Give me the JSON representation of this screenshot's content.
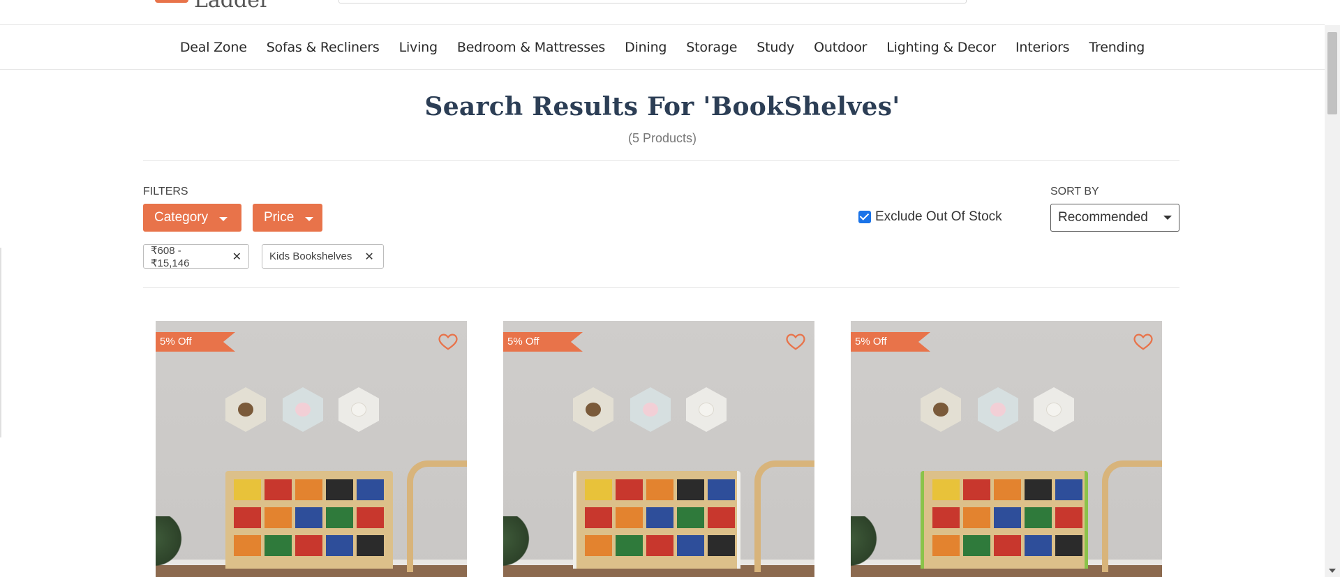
{
  "header": {
    "logo_text": "Ladder"
  },
  "nav": {
    "items": [
      "Deal Zone",
      "Sofas & Recliners",
      "Living",
      "Bedroom & Mattresses",
      "Dining",
      "Storage",
      "Study",
      "Outdoor",
      "Lighting & Decor",
      "Interiors",
      "Trending"
    ]
  },
  "results": {
    "title": "Search Results For 'BookShelves'",
    "count": "(5 Products)"
  },
  "filters": {
    "label": "FILTERS",
    "category_label": "Category",
    "price_label": "Price",
    "chips": [
      "₹608 - ₹15,146",
      "Kids Bookshelves"
    ]
  },
  "stock": {
    "label": "Exclude Out Of Stock",
    "checked": true
  },
  "sort": {
    "label": "SORT BY",
    "selected": "Recommended"
  },
  "products": [
    {
      "badge": "5% Off"
    },
    {
      "badge": "5% Off"
    },
    {
      "badge": "5% Off"
    }
  ],
  "colors": {
    "accent": "#e8734a",
    "heading": "#2c3e55",
    "checkbox": "#1a73e8"
  }
}
